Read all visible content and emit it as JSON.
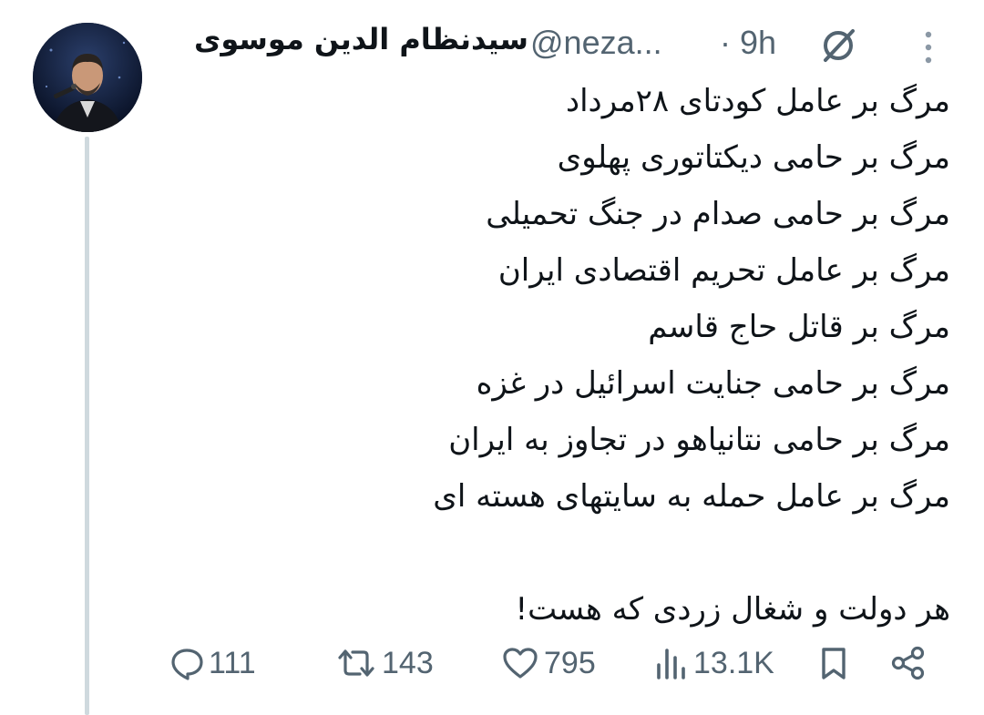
{
  "tweet": {
    "display_name": "سیدنظام الدین موسوی",
    "handle": "@neza...",
    "separator": "·",
    "timestamp": "9h",
    "lines": [
      "مرگ بر عامل کودتای ۲۸مرداد",
      "مرگ بر حامی دیکتاتوری پهلوی",
      "مرگ بر حامی صدام در جنگ تحمیلی",
      "مرگ بر عامل تحریم اقتصادی ایران",
      "مرگ بر قاتل حاج قاسم",
      "مرگ بر حامی جنایت اسرائیل در غزه",
      "مرگ بر حامی نتانیاهو در تجاوز به ایران",
      "مرگ بر عامل حمله به سایتهای هسته ای"
    ],
    "closing_line": "هر دولت و شغال زردی که هست!"
  },
  "actions": {
    "replies": "111",
    "reposts": "143",
    "likes": "795",
    "views": "13.1K"
  },
  "icons": {
    "reply": "reply-icon",
    "repost": "repost-icon",
    "like": "heart-icon",
    "views": "views-icon",
    "bookmark": "bookmark-icon",
    "share": "share-icon",
    "grok": "grok-icon",
    "more": "more-icon"
  },
  "colors": {
    "text_primary": "#0f1419",
    "text_secondary": "#536471",
    "thread_line": "#cfd9de"
  }
}
